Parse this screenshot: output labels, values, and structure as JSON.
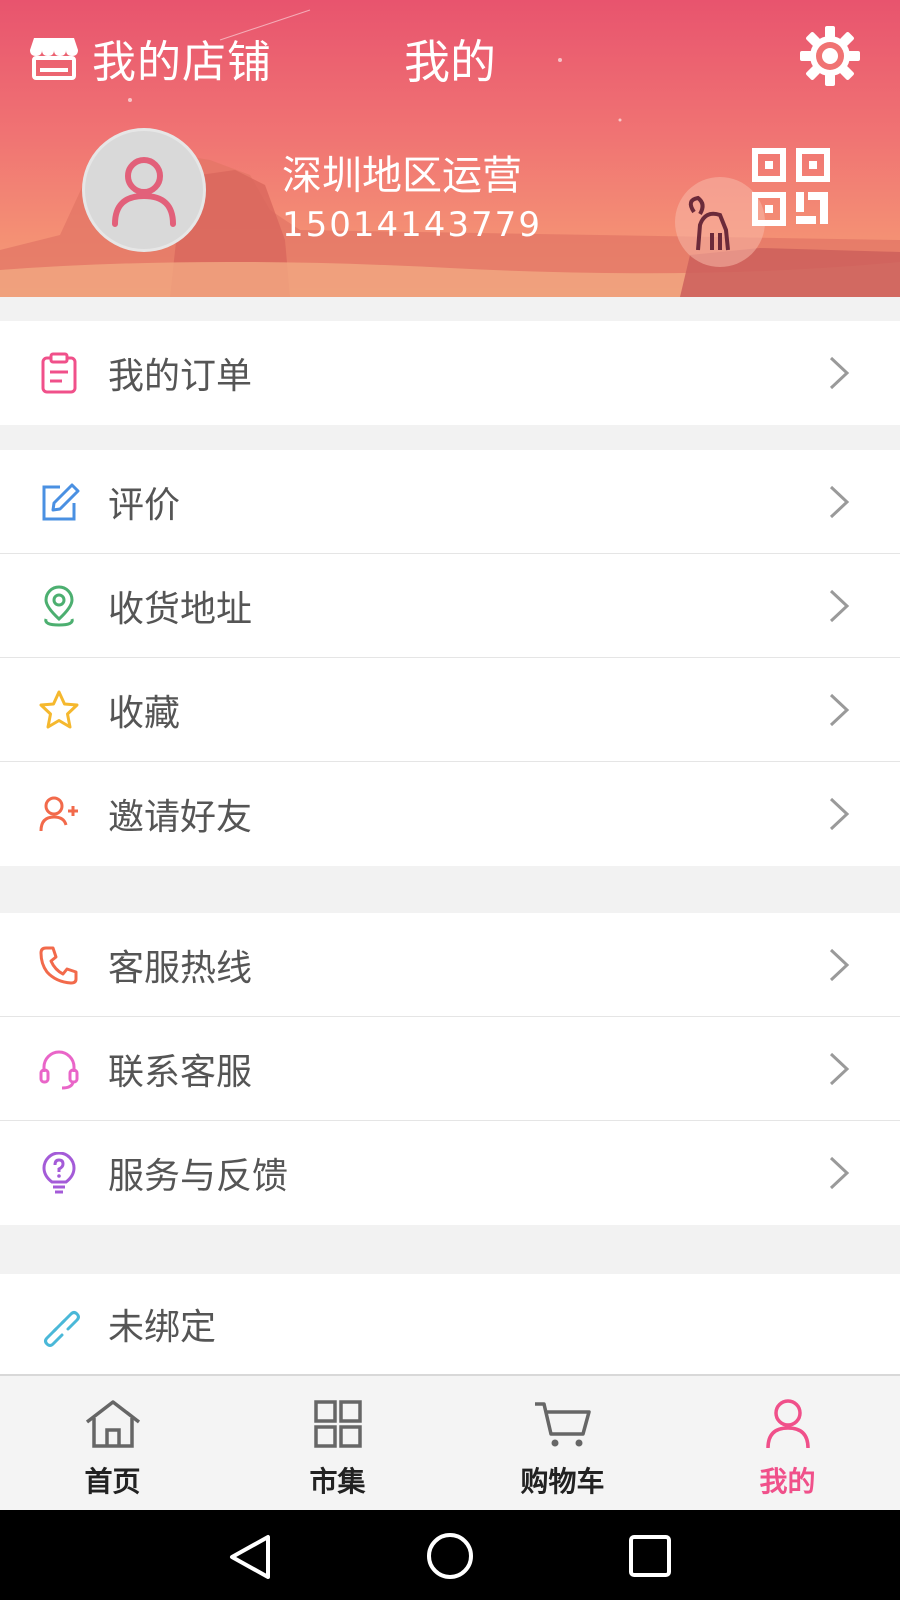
{
  "header": {
    "store_label": "我的店铺",
    "title": "我的",
    "user_name": "深圳地区运营",
    "user_phone": "15014143779"
  },
  "menu_groups": [
    [
      {
        "label": "我的订单",
        "icon": "clipboard-icon",
        "color": "#f0508a"
      }
    ],
    [
      {
        "label": "评价",
        "icon": "edit-icon",
        "color": "#4a90e2"
      },
      {
        "label": "收货地址",
        "icon": "location-pin-icon",
        "color": "#4caf70"
      },
      {
        "label": "收藏",
        "icon": "star-icon",
        "color": "#f5b82e"
      },
      {
        "label": "邀请好友",
        "icon": "add-user-icon",
        "color": "#f26a4b"
      }
    ],
    [
      {
        "label": "客服热线",
        "icon": "phone-icon",
        "color": "#f26a4b"
      },
      {
        "label": "联系客服",
        "icon": "headset-icon",
        "color": "#e965c8"
      },
      {
        "label": "服务与反馈",
        "icon": "lightbulb-icon",
        "color": "#a45bd8"
      }
    ],
    [
      {
        "label": "未绑定",
        "icon": "link-icon",
        "color": "#4ab8d8"
      }
    ]
  ],
  "tabs": [
    {
      "label": "首页",
      "icon": "home-icon",
      "active": false
    },
    {
      "label": "市集",
      "icon": "grid-icon",
      "active": false
    },
    {
      "label": "购物车",
      "icon": "cart-icon",
      "active": false
    },
    {
      "label": "我的",
      "icon": "user-icon",
      "active": true
    }
  ],
  "colors": {
    "accent": "#f0508a",
    "header_top": "#e8546e",
    "header_bottom": "#f3a07a"
  }
}
